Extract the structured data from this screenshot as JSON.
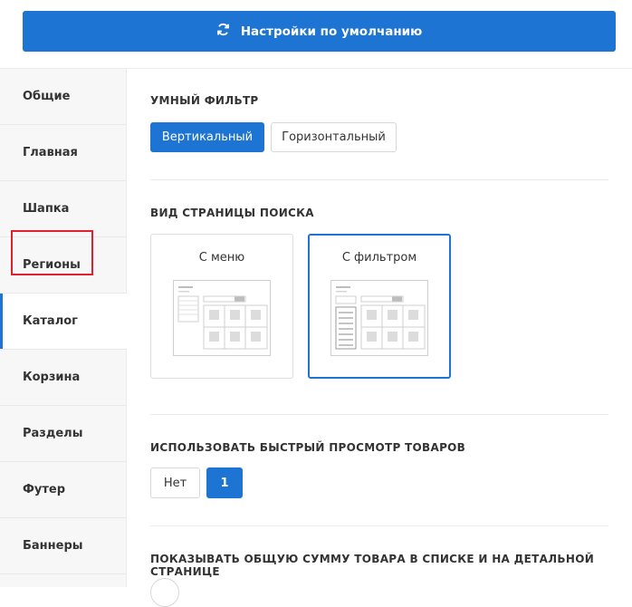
{
  "header": {
    "reset_label": "Настройки по умолчанию"
  },
  "sidebar": {
    "items": [
      {
        "label": "Общие"
      },
      {
        "label": "Главная"
      },
      {
        "label": "Шапка"
      },
      {
        "label": "Регионы"
      },
      {
        "label": "Каталог"
      },
      {
        "label": "Корзина"
      },
      {
        "label": "Разделы"
      },
      {
        "label": "Футер"
      },
      {
        "label": "Баннеры"
      }
    ],
    "active": "Каталог"
  },
  "smart_filter": {
    "title": "УМНЫЙ ФИЛЬТР",
    "options": [
      "Вертикальный",
      "Горизонтальный"
    ],
    "selected": "Вертикальный"
  },
  "search_page": {
    "title": "ВИД СТРАНИЦЫ ПОИСКА",
    "options": [
      "С меню",
      "С фильтром"
    ],
    "selected": "С фильтром"
  },
  "quick_view": {
    "title": "ИСПОЛЬЗОВАТЬ БЫСТРЫЙ ПРОСМОТР ТОВАРОВ",
    "options": [
      "Нет",
      "1"
    ],
    "selected": "1"
  },
  "total_sum": {
    "title": "ПОКАЗЫВАТЬ ОБЩУЮ СУММУ ТОВАРА В СПИСКЕ И НА ДЕТАЛЬНОЙ СТРАНИЦЕ"
  },
  "colors": {
    "accent": "#1d74d2",
    "highlight": "#e0202c"
  }
}
